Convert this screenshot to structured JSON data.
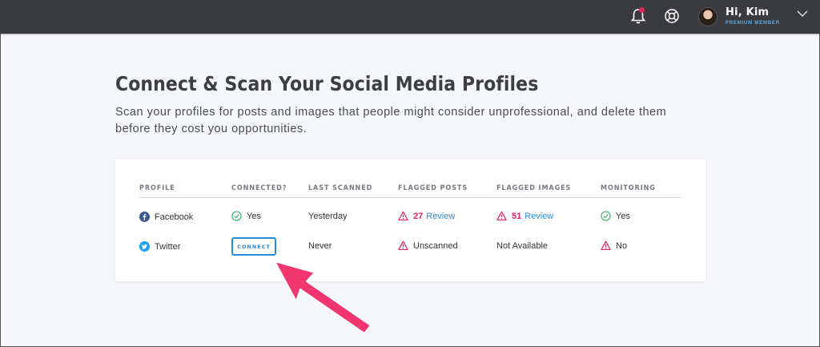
{
  "header": {
    "greeting": "Hi, Kim",
    "membership": "PREMIUM MEMBER",
    "icons": [
      "bell-icon",
      "help-icon",
      "avatar",
      "chevron-down-icon"
    ],
    "notification_color": "#e0245e"
  },
  "page": {
    "title": "Connect & Scan Your Social Media Profiles",
    "description": "Scan your profiles for posts and images that people might consider unprofessional, and delete them before they cost you opportunities."
  },
  "table": {
    "columns": [
      "PROFILE",
      "CONNECTED?",
      "LAST SCANNED",
      "FLAGGED POSTS",
      "FLAGGED IMAGES",
      "MONITORING"
    ],
    "rows": [
      {
        "profile": "Facebook",
        "connected": "Yes",
        "last_scanned": "Yesterday",
        "flagged_posts_count": "27",
        "flagged_posts_link": "Review",
        "flagged_images_count": "51",
        "flagged_images_link": "Review",
        "monitoring": "Yes"
      },
      {
        "profile": "Twitter",
        "connect_button": "CONNECT",
        "last_scanned": "Never",
        "flagged_posts": "Unscanned",
        "flagged_images": "Not Available",
        "monitoring": "No"
      }
    ]
  },
  "colors": {
    "accent": "#2b8ad6",
    "warning": "#e0245e",
    "success": "#3cb371",
    "topbar": "#3a3b3e",
    "callout_arrow": "#f0356f"
  }
}
